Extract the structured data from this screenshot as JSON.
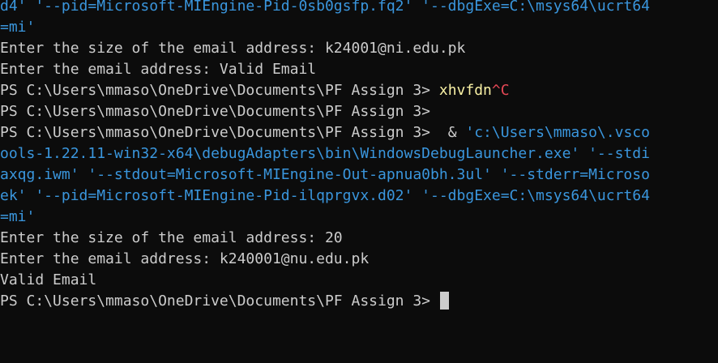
{
  "terminal": {
    "lines": [
      [
        {
          "text": "d4' '--pid=Microsoft-MIEngine-Pid-0sb0gsfp.fq2' '--dbgExe=C:\\msys64\\ucrt64",
          "color": "cyan"
        }
      ],
      [
        {
          "text": "=mi'",
          "color": "cyan"
        }
      ],
      [
        {
          "text": "Enter the size of the email address: k24001@ni.edu.pk",
          "color": "default"
        }
      ],
      [
        {
          "text": "Enter the email address: Valid Email",
          "color": "default"
        }
      ],
      [
        {
          "text": "PS C:\\Users\\mmaso\\OneDrive\\Documents\\PF Assign 3> ",
          "color": "default"
        },
        {
          "text": "xhvfdn",
          "color": "yellow"
        },
        {
          "text": "^C",
          "color": "red"
        }
      ],
      [
        {
          "text": "PS C:\\Users\\mmaso\\OneDrive\\Documents\\PF Assign 3>",
          "color": "default"
        }
      ],
      [
        {
          "text": "PS C:\\Users\\mmaso\\OneDrive\\Documents\\PF Assign 3>  ",
          "color": "default"
        },
        {
          "text": "& ",
          "color": "default"
        },
        {
          "text": "'c:\\Users\\mmaso\\.vsco",
          "color": "cyan"
        }
      ],
      [
        {
          "text": "ools-1.22.11-win32-x64\\debugAdapters\\bin\\WindowsDebugLauncher.exe' '--stdi",
          "color": "cyan"
        }
      ],
      [
        {
          "text": "axqg.iwm' '--stdout=Microsoft-MIEngine-Out-apnua0bh.3ul' '--stderr=Microso",
          "color": "cyan"
        }
      ],
      [
        {
          "text": "ek' '--pid=Microsoft-MIEngine-Pid-ilqprgvx.d02' '--dbgExe=C:\\msys64\\ucrt64",
          "color": "cyan"
        }
      ],
      [
        {
          "text": "=mi'",
          "color": "cyan"
        }
      ],
      [
        {
          "text": "Enter the size of the email address: 20",
          "color": "default"
        }
      ],
      [
        {
          "text": "Enter the email address: k240001@nu.edu.pk",
          "color": "default"
        }
      ],
      [
        {
          "text": "Valid Email",
          "color": "default"
        }
      ],
      [
        {
          "text": "PS C:\\Users\\mmaso\\OneDrive\\Documents\\PF Assign 3> ",
          "color": "default"
        }
      ]
    ],
    "cursor_line": 14
  },
  "colors": {
    "background": "#0c0c0c",
    "default": "#cccccc",
    "cyan": "#3a96dd",
    "yellow": "#f9f1a5",
    "red": "#e74856"
  }
}
